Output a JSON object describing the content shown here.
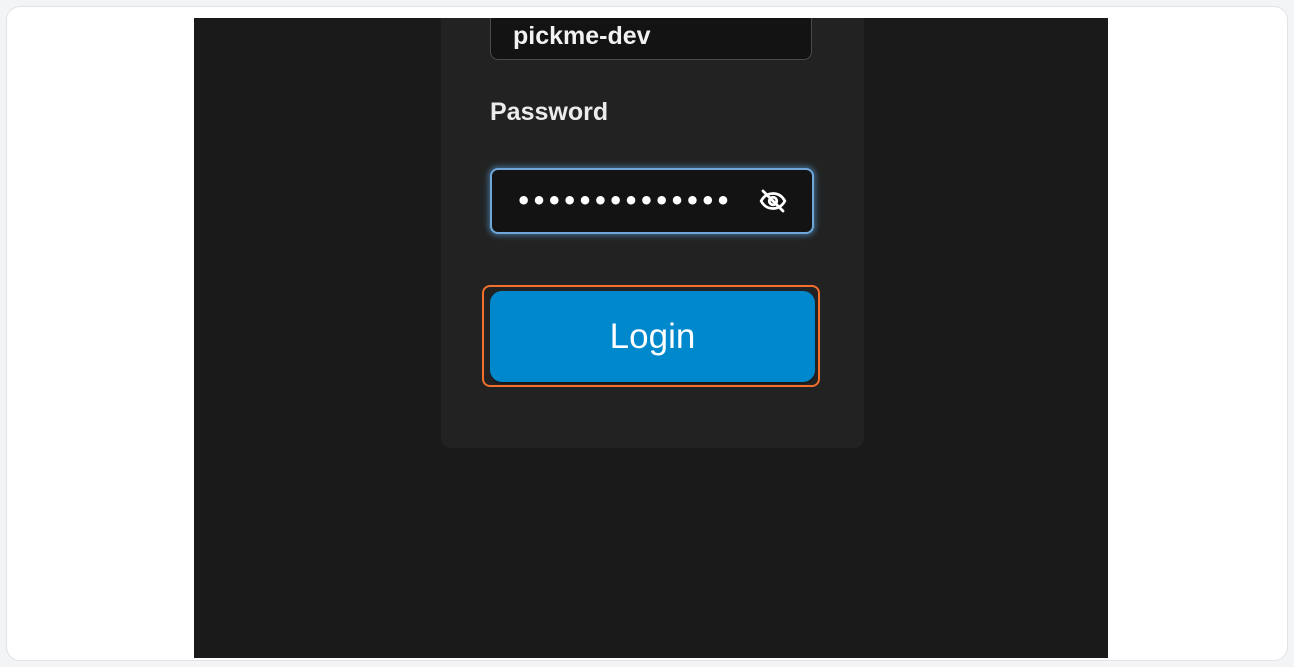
{
  "login_form": {
    "username_value": "pickme-dev",
    "password_label": "Password",
    "password_value": "••••••••••••••",
    "password_visibility_icon": "eye-off-icon",
    "login_label": "Login"
  },
  "colors": {
    "page_background": "#1a1a1a",
    "card_background": "#222222",
    "input_background": "#131313",
    "focus_border": "#6fa8d8",
    "primary_button": "#0088cc",
    "highlight_outline": "#f36f2c"
  }
}
